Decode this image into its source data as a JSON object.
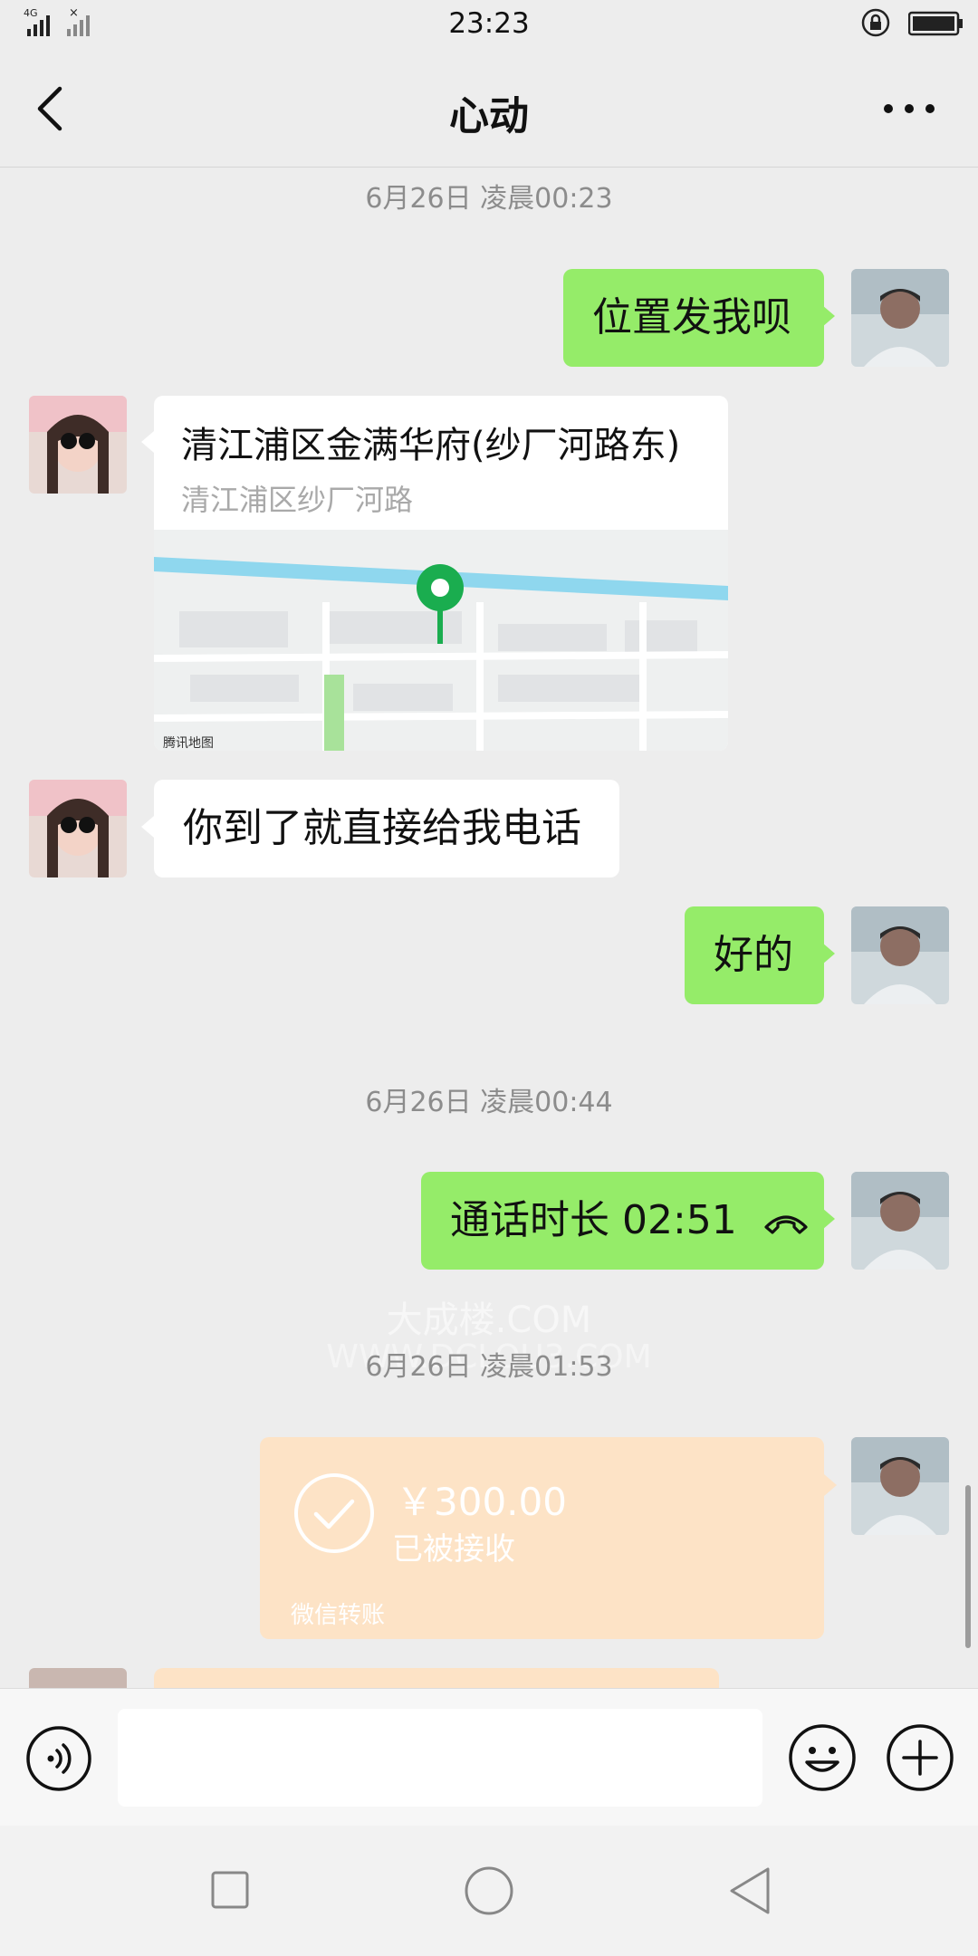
{
  "status_bar": {
    "time": "23:23",
    "network": "4G"
  },
  "header": {
    "title": "心动"
  },
  "messages": {
    "ts1": "6月26日 凌晨00:23",
    "m1": "位置发我呗",
    "location": {
      "title": "清江浦区金满华府(纱厂河路东)",
      "address": "清江浦区纱厂河路",
      "map_provider": "腾讯地图"
    },
    "m2": "你到了就直接给我电话",
    "m3": "好的",
    "ts2": "6月26日 凌晨00:44",
    "call": "通话时长 02:51",
    "ts3": "6月26日 凌晨01:53",
    "transfer": {
      "amount": "￥300.00",
      "status": "已被接收",
      "label": "微信转账"
    }
  },
  "watermark": {
    "line1": "大成楼.COM",
    "line2": "WWW.DCLOU3.COM"
  },
  "input": {
    "value": ""
  },
  "colors": {
    "self_bubble": "#95ec69",
    "other_bubble": "#ffffff",
    "transfer_bubble": "#fde3c6",
    "background": "#ededed"
  }
}
